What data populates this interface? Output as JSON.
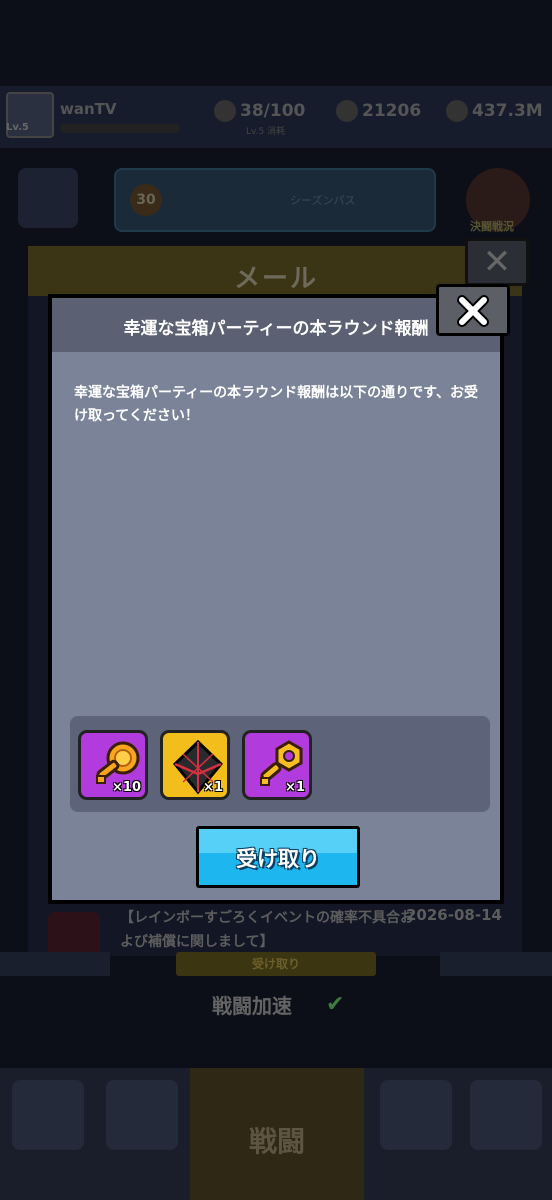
{
  "background": {
    "player": {
      "name": "wanTV",
      "level": "Lv.5"
    },
    "stats": [
      {
        "icon": "energy-icon",
        "value": "38/100"
      },
      {
        "icon": "gem-icon",
        "value": "21206"
      },
      {
        "icon": "coin-icon",
        "value": "437.3M"
      }
    ],
    "stats_sub": "Lv.5 消耗",
    "season": {
      "level": "30",
      "text": "シーズンパス"
    },
    "side_button": "決闘戦況",
    "mail_panel_title": "メール",
    "mail_row": {
      "title": "【レインボーすごろくイベントの確率不具合および補償に関しまして】",
      "date": "2026-08-14",
      "button": "受け取り"
    },
    "battle_speed": "戦闘加速",
    "battle_nav": "戦闘"
  },
  "modal": {
    "title": "幸運な宝箱パーティーの本ラウンド報酬",
    "body": "幸運な宝箱パーティーの本ラウンド報酬は以下の通りです、お受け取ってください！",
    "rewards": [
      {
        "icon": "purple-coin-key-icon",
        "qty": "×10",
        "color": "#b13bdc"
      },
      {
        "icon": "dark-crystal-icon",
        "qty": "×1",
        "color": "#f3bd1c"
      },
      {
        "icon": "purple-hex-key-icon",
        "qty": "×1",
        "color": "#b13bdc"
      }
    ],
    "claim_button": "受け取り"
  }
}
